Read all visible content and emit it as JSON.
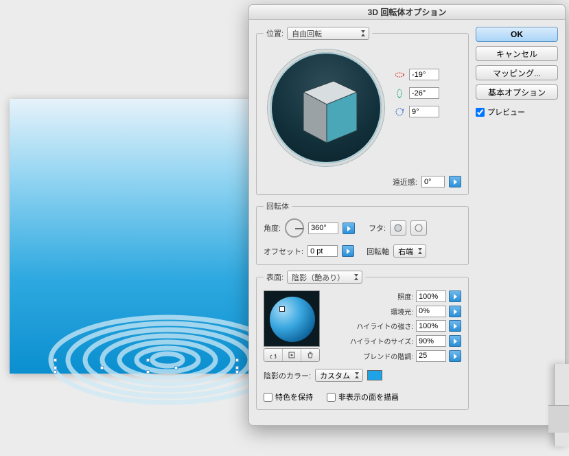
{
  "dialog": {
    "title": "3D 回転体オプション",
    "buttons": {
      "ok": "OK",
      "cancel": "キャンセル",
      "mapping": "マッピング...",
      "basic": "基本オプション"
    },
    "preview_checkbox": "プレビュー",
    "position": {
      "legend": "位置:",
      "mode": "自由回転",
      "rx": "-19°",
      "ry": "-26°",
      "rz": "9°",
      "perspective_label": "遠近感:",
      "perspective": "0°"
    },
    "revolve": {
      "legend": "回転体",
      "angle_label": "角度:",
      "angle": "360°",
      "cap_label": "フタ:",
      "offset_label": "オフセット:",
      "offset": "0 pt",
      "axis_label": "回転軸",
      "axis": "右端"
    },
    "surface": {
      "legend": "表面:",
      "shading": "陰影（艶あり）",
      "intensity_label": "照度:",
      "intensity": "100%",
      "ambient_label": "環境光:",
      "ambient": "0%",
      "hi_strength_label": "ハイライトの強さ:",
      "hi_strength": "100%",
      "hi_size_label": "ハイライトのサイズ:",
      "hi_size": "90%",
      "blend_label": "ブレンドの階調:",
      "blend": "25",
      "shade_color_label": "陰影のカラー:",
      "shade_color_mode": "カスタム",
      "shade_color": "#1ea3e6",
      "preserve_spot": "特色を保持",
      "draw_hidden": "非表示の面を描画"
    }
  }
}
